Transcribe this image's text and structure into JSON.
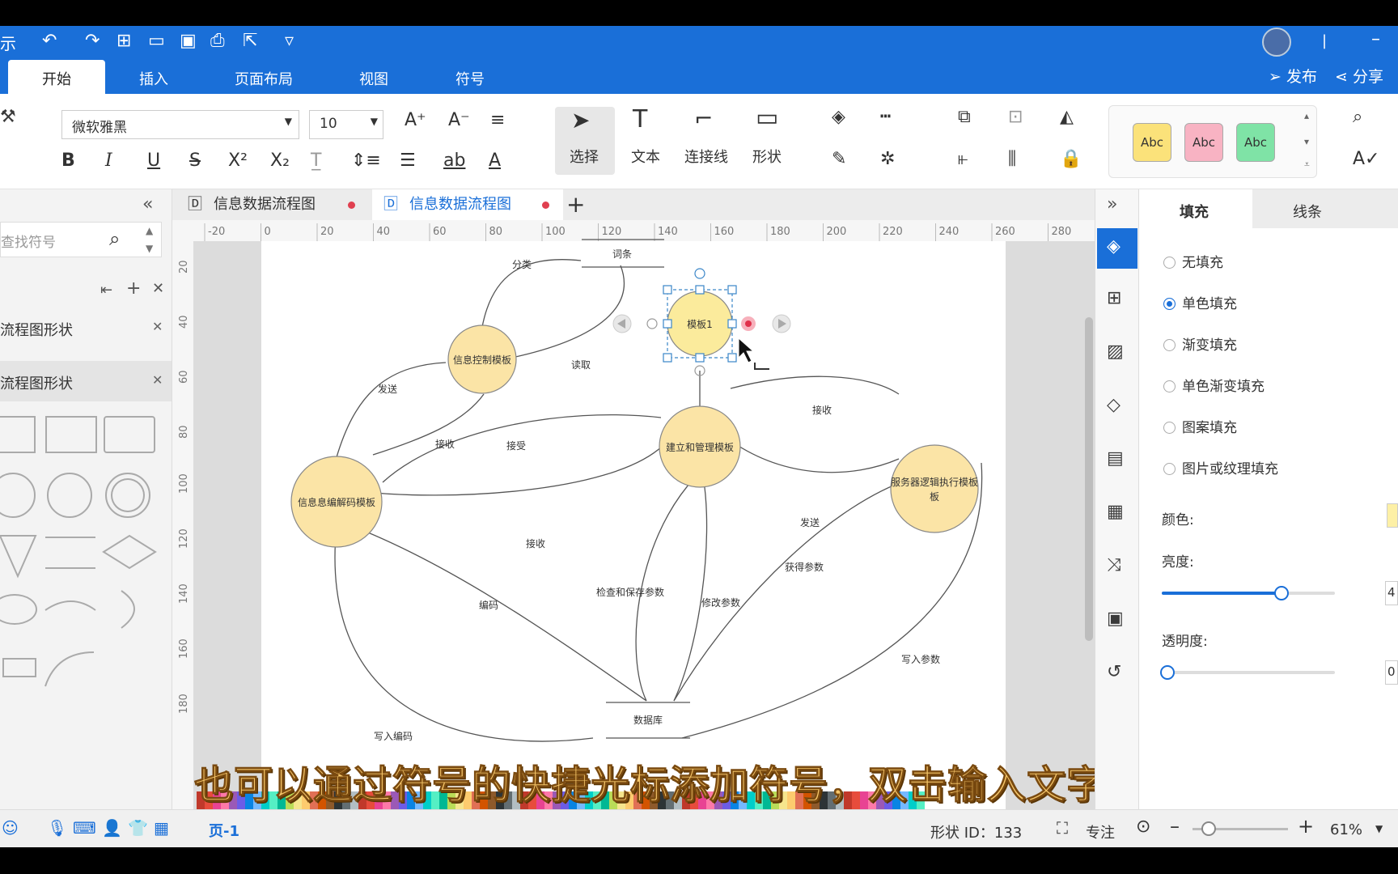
{
  "toolbar": {
    "partial_app": "示"
  },
  "menu_tabs": [
    "开始",
    "插入",
    "页面布局",
    "视图",
    "符号"
  ],
  "actions": {
    "publish": "发布",
    "share": "分享"
  },
  "font": {
    "name": "微软雅黑",
    "size": "10"
  },
  "format": {
    "bold": "B",
    "italic": "I",
    "underline": "U",
    "strike": "S",
    "sup": "X²",
    "sub": "X₂"
  },
  "tools": [
    {
      "label": "选择",
      "icon": "pointer-icon"
    },
    {
      "label": "文本",
      "icon": "text-icon"
    },
    {
      "label": "连接线",
      "icon": "connector-icon"
    },
    {
      "label": "形状",
      "icon": "rectangle-icon"
    }
  ],
  "styles": [
    {
      "label": "Abc",
      "color": "#fbe27a"
    },
    {
      "label": "Abc",
      "color": "#f8b3c3"
    },
    {
      "label": "Abc",
      "color": "#7fe3a6"
    }
  ],
  "left": {
    "search_placeholder": "查找符号",
    "lib1": "流程图形状",
    "lib2": "流程图形状"
  },
  "doc_tabs": [
    "信息数据流程图",
    "信息数据流程图"
  ],
  "ruler": [
    "-20",
    "0",
    "20",
    "40",
    "60",
    "80",
    "100",
    "120",
    "140",
    "160",
    "180",
    "200",
    "220",
    "240",
    "260",
    "280"
  ],
  "vruler": [
    "20",
    "40",
    "60",
    "80",
    "100",
    "120",
    "140",
    "160",
    "180"
  ],
  "diagram": {
    "nodes": [
      "信息控制模板",
      "建立和管理模板",
      "信息息编解码模板",
      "服务器逻辑执行模板",
      "模板1"
    ],
    "node_line2": "板",
    "stores": [
      "词条",
      "数据库"
    ],
    "edges": [
      "分类",
      "读取",
      "发送",
      "接收",
      "接受",
      "接收",
      "接收",
      "发送",
      "获得参数",
      "检查和保存参数",
      "修改参数",
      "编码",
      "写入参数",
      "写入编码"
    ]
  },
  "panel": {
    "tab_fill": "填充",
    "tab_line": "线条",
    "options": [
      "无填充",
      "单色填充",
      "渐变填充",
      "单色渐变填充",
      "图案填充",
      "图片或纹理填充"
    ],
    "selected_index": 1,
    "color_label": "颜色:",
    "brightness_label": "亮度:",
    "opacity_label": "透明度:",
    "brightness_val": "4",
    "opacity_val": "0",
    "brightness": 0.69,
    "opacity": 0.0
  },
  "status": {
    "page": "页-1",
    "shape_id": "形状 ID：133",
    "focus": "专注",
    "zoom": "61%"
  },
  "subtitle": "也可以通过符号的快捷光标添加符号，双击输入文字"
}
